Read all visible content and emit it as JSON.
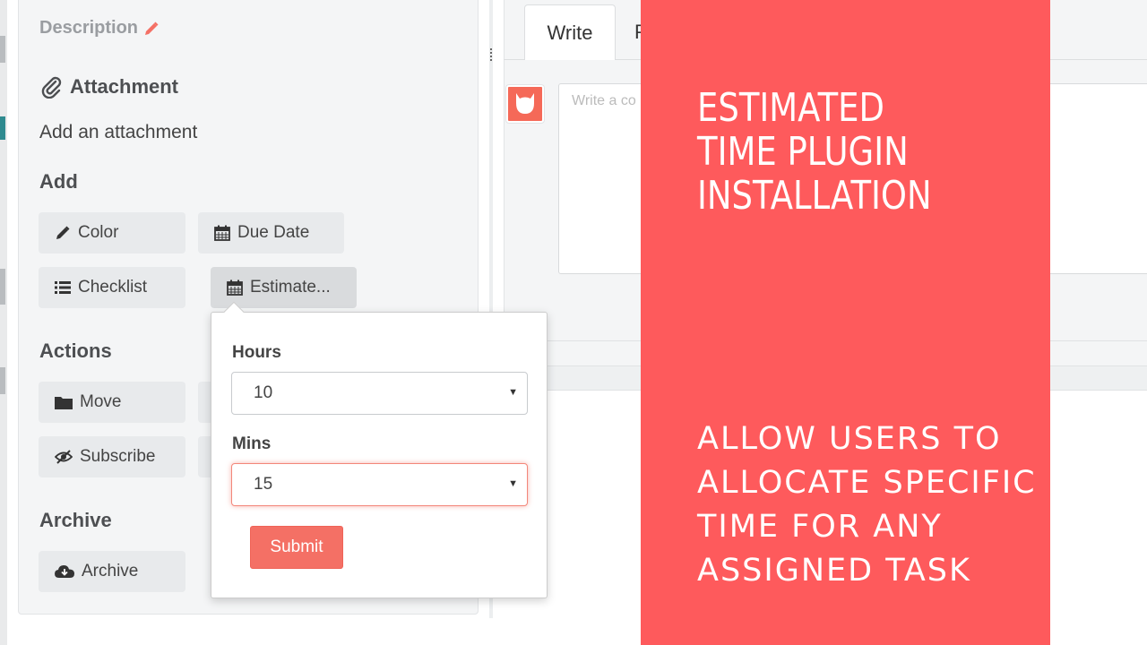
{
  "card": {
    "description_label": "Description",
    "attachment_title": "Attachment",
    "add_attachment_text": "Add an attachment",
    "add_title": "Add",
    "add_buttons": {
      "color": "Color",
      "due_date": "Due Date",
      "checklist": "Checklist",
      "estimate": "Estimate..."
    },
    "actions_title": "Actions",
    "actions_buttons": {
      "move": "Move",
      "subscribe": "Subscribe"
    },
    "archive_title": "Archive",
    "archive_button": "Archive"
  },
  "comment": {
    "tab_write": "Write",
    "tab_preview": "P",
    "placeholder": "Write a co"
  },
  "estimate_popover": {
    "hours_label": "Hours",
    "hours_value": "10",
    "mins_label": "Mins",
    "mins_value": "15",
    "submit_label": "Submit"
  },
  "promo": {
    "title": "ESTIMATED TIME PLUGIN INSTALLATION",
    "subtitle": "ALLOW USERS TO ALLOCATE SPECIFIC TIME FOR ANY ASSIGNED TASK"
  },
  "icons": {
    "description": "pencil-icon",
    "attachment": "paperclip-icon",
    "color": "pencil-icon",
    "due_date": "calendar-icon",
    "checklist": "list-icon",
    "estimate": "calendar-icon",
    "move": "folder-icon",
    "subscribe": "eye-slash-icon",
    "archive": "cloud-download-icon"
  },
  "colors": {
    "accent": "#f47065",
    "promo_background": "#fe5a5c",
    "panel": "#f4f5f6"
  }
}
